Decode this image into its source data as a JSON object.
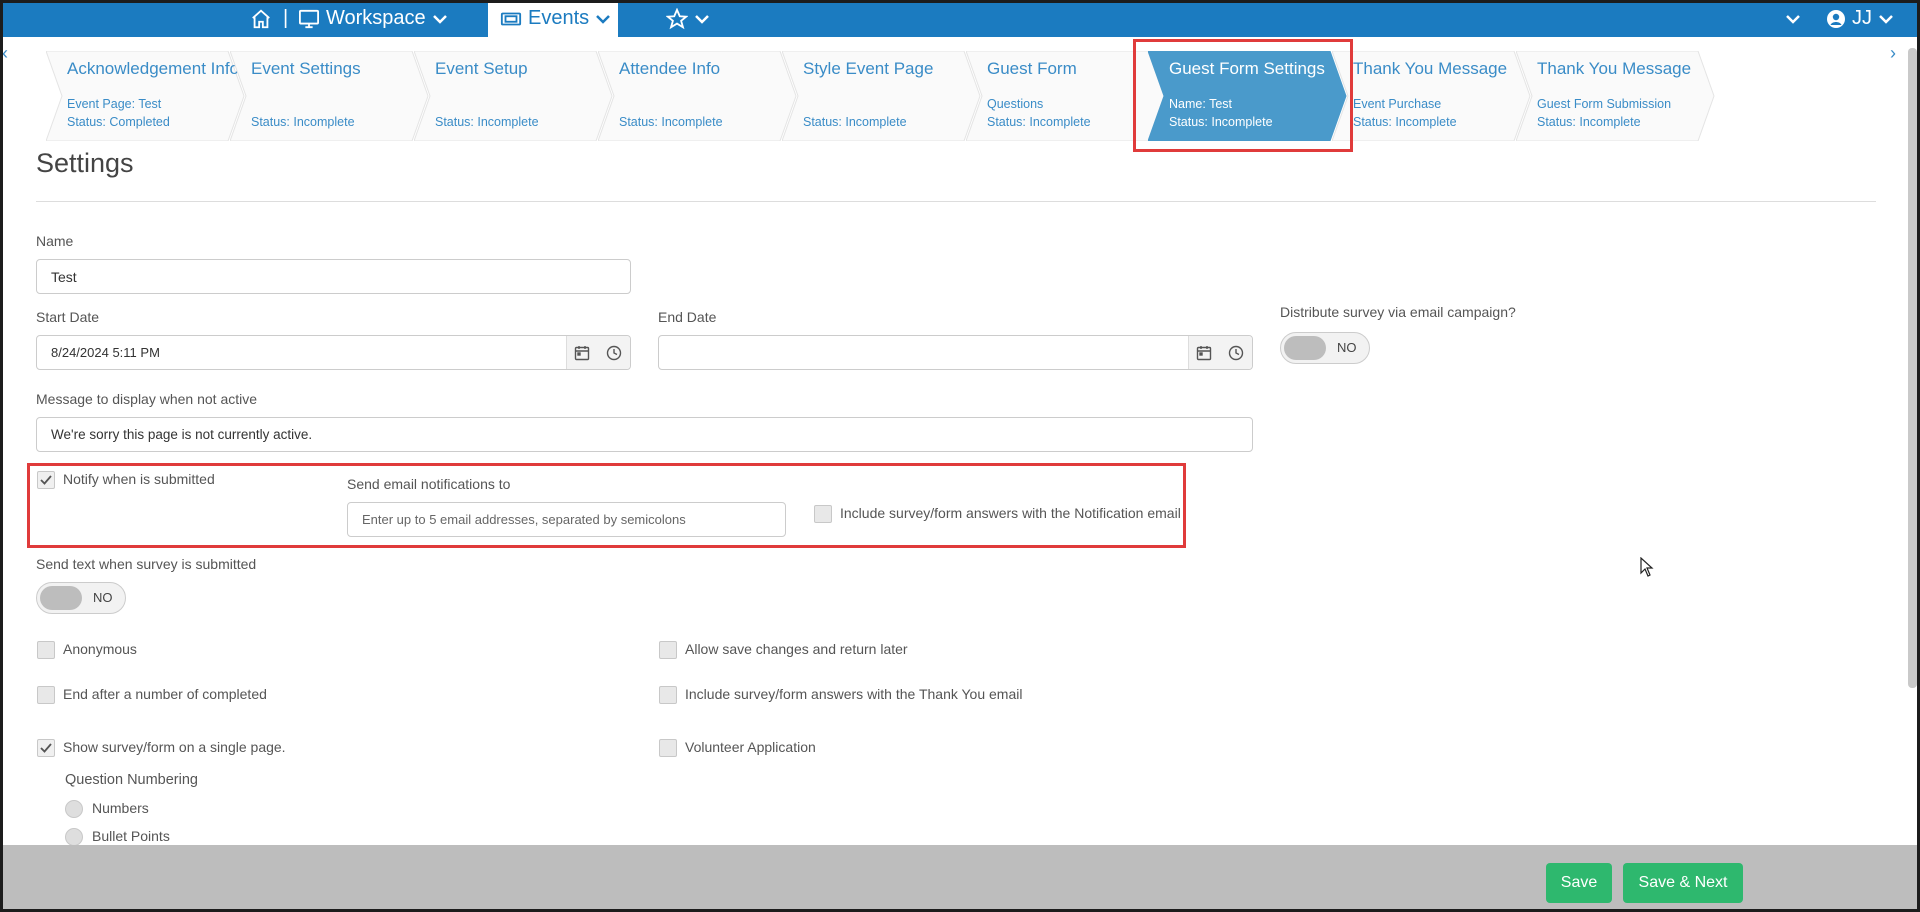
{
  "topbar": {
    "workspace_label": "Workspace",
    "events_label": "Events",
    "user_initials": "JJ",
    "separator": "|"
  },
  "wizard": {
    "steps": [
      {
        "title": "Acknowledgement Info",
        "line1": "Event Page: Test",
        "line2": "Status: Completed"
      },
      {
        "title": "Event Settings",
        "line1": "",
        "line2": "Status: Incomplete"
      },
      {
        "title": "Event Setup",
        "line1": "",
        "line2": "Status: Incomplete"
      },
      {
        "title": "Attendee Info",
        "line1": "",
        "line2": "Status: Incomplete"
      },
      {
        "title": "Style Event Page",
        "line1": "",
        "line2": "Status: Incomplete"
      },
      {
        "title": "Guest Form",
        "line1": "Questions",
        "line2": "Status: Incomplete"
      },
      {
        "title": "Guest Form Settings",
        "line1": "Name: Test",
        "line2": "Status: Incomplete"
      },
      {
        "title": "Thank You Message",
        "line1": "Event Purchase",
        "line2": "Status: Incomplete"
      },
      {
        "title": "Thank You Message",
        "line1": "Guest Form Submission",
        "line2": "Status: Incomplete"
      }
    ],
    "active_step": 6,
    "left_arrow": "‹",
    "right_arrow": "›"
  },
  "settings": {
    "title": "Settings",
    "name_label": "Name",
    "name_value": "Test",
    "start_date_label": "Start Date",
    "start_date_value": "8/24/2024 5:11 PM",
    "end_date_label": "End Date",
    "end_date_value": "",
    "distribute_label": "Distribute survey via email campaign?",
    "distribute_toggle": "NO",
    "message_label": "Message to display when not active",
    "message_value": "We're sorry this page is not currently active.",
    "notify_label": "Notify when is submitted",
    "notify_checked": true,
    "send_email_label": "Send email notifications to",
    "send_email_placeholder": "Enter up to 5 email addresses, separated by semicolons",
    "include_notification_label": "Include survey/form answers with the Notification email",
    "send_text_label": "Send text when survey is submitted",
    "send_text_toggle": "NO",
    "anonymous_label": "Anonymous",
    "allow_save_label": "Allow save changes and return later",
    "end_after_label": "End after a number of completed",
    "include_thankyou_label": "Include survey/form answers with the Thank You email",
    "single_page_label": "Show survey/form on a single page.",
    "single_page_checked": true,
    "volunteer_label": "Volunteer Application",
    "question_numbering_label": "Question Numbering",
    "numbering_options": [
      "Numbers",
      "Bullet Points"
    ]
  },
  "footer": {
    "save_label": "Save",
    "save_next_label": "Save & Next"
  },
  "colors": {
    "brand_blue": "#1b7bc0",
    "active_step": "#4a9acb",
    "save_green": "#2eb86e",
    "highlight_red": "#e03b3b"
  }
}
